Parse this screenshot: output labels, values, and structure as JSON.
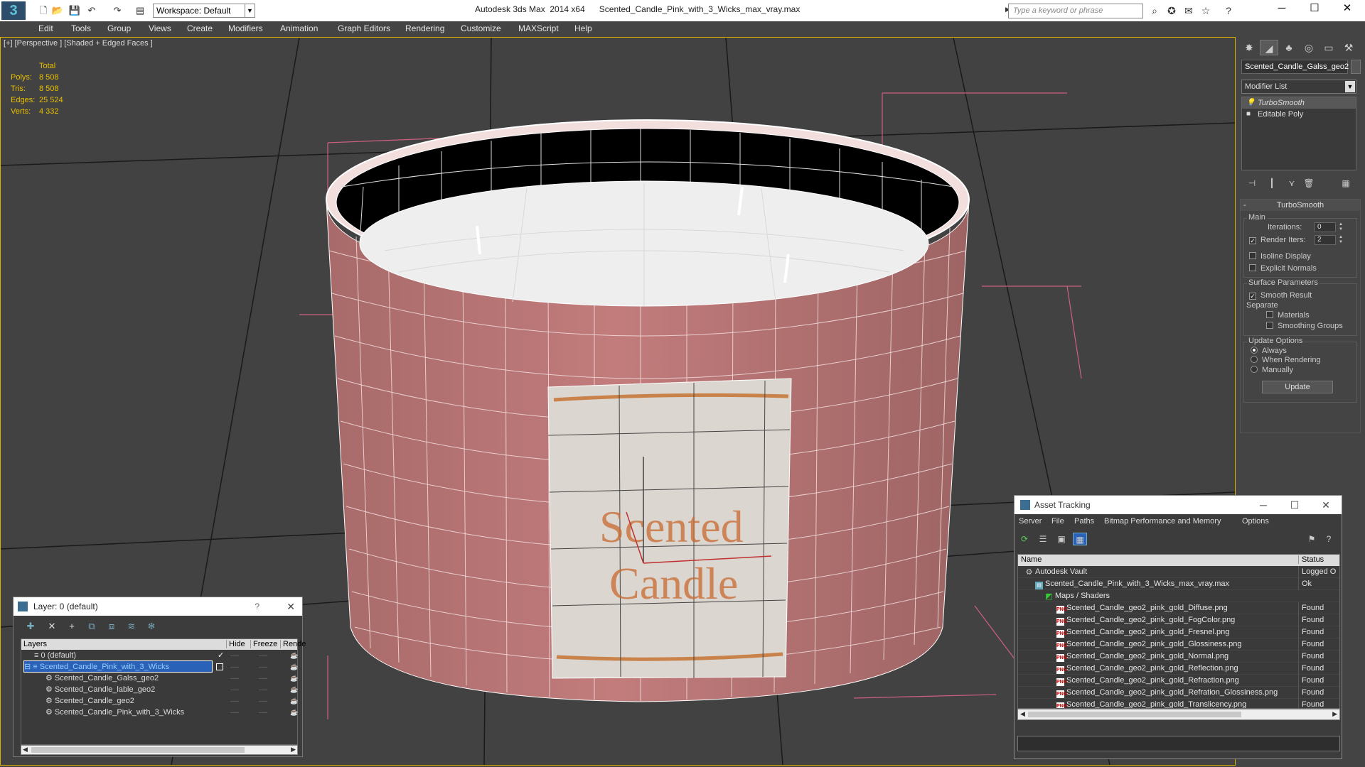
{
  "titlebar": {
    "app_title": "Autodesk 3ds Max  2014 x64      Scented_Candle_Pink_with_3_Wicks_max_vray.max",
    "workspace_label": "Workspace: Default",
    "search_placeholder": "Type a keyword or phrase",
    "minimize": "─",
    "maximize": "☐",
    "close": "✕"
  },
  "menu": [
    "Edit",
    "Tools",
    "Group",
    "Views",
    "Create",
    "Modifiers",
    "Animation",
    "Graph Editors",
    "Rendering",
    "Customize",
    "MAXScript",
    "Help"
  ],
  "viewport": {
    "label": "[+] [Perspective ] [Shaded + Edged Faces ]",
    "stats_header": "Total",
    "stats": [
      {
        "label": "Polys:",
        "value": "8 508"
      },
      {
        "label": "Tris:",
        "value": "8 508"
      },
      {
        "label": "Edges:",
        "value": "25 524"
      },
      {
        "label": "Verts:",
        "value": "4 332"
      }
    ],
    "label_text_line1": "Scented",
    "label_text_line2": "Candle"
  },
  "command_panel": {
    "object_name": "Scented_Candle_Galss_geo2",
    "modifier_list": "Modifier List",
    "stack": [
      "TurboSmooth",
      "Editable Poly"
    ],
    "rollout_title": "TurboSmooth",
    "main_group": "Main",
    "iterations_label": "Iterations:",
    "iterations_value": "0",
    "render_iters_label": "Render Iters:",
    "render_iters_value": "2",
    "isoline_display": "Isoline Display",
    "explicit_normals": "Explicit Normals",
    "surface_group": "Surface Parameters",
    "smooth_result": "Smooth Result",
    "separate_label": "Separate",
    "materials": "Materials",
    "smoothing_groups": "Smoothing Groups",
    "update_group": "Update Options",
    "always": "Always",
    "when_rendering": "When Rendering",
    "manually": "Manually",
    "update_button": "Update"
  },
  "layer_window": {
    "title": "Layer: 0 (default)",
    "help": "?",
    "close": "✕",
    "columns": [
      "Layers",
      "Hide",
      "Freeze",
      "Rende"
    ],
    "rows": [
      {
        "name": "0 (default)"
      },
      {
        "name": "Scented_Candle_Pink_with_3_Wicks"
      },
      {
        "name": "Scented_Candle_Galss_geo2"
      },
      {
        "name": "Scented_Candle_lable_geo2"
      },
      {
        "name": "Scented_Candle_geo2"
      },
      {
        "name": "Scented_Candle_Pink_with_3_Wicks"
      }
    ],
    "dash": "----"
  },
  "asset_window": {
    "title": "Asset Tracking",
    "minimize": "─",
    "maximize": "☐",
    "close": "✕",
    "menu": [
      "Server",
      "File",
      "Paths",
      "Bitmap Performance and Memory",
      "Options"
    ],
    "columns": [
      "Name",
      "Status"
    ],
    "rows": [
      {
        "name": "Autodesk Vault",
        "status": "Logged O"
      },
      {
        "name": "Scented_Candle_Pink_with_3_Wicks_max_vray.max",
        "status": "Ok"
      },
      {
        "name": "Maps / Shaders",
        "status": ""
      },
      {
        "name": "Scented_Candle_geo2_pink_gold_Diffuse.png",
        "status": "Found"
      },
      {
        "name": "Scented_Candle_geo2_pink_gold_FogColor.png",
        "status": "Found"
      },
      {
        "name": "Scented_Candle_geo2_pink_gold_Fresnel.png",
        "status": "Found"
      },
      {
        "name": "Scented_Candle_geo2_pink_gold_Glossiness.png",
        "status": "Found"
      },
      {
        "name": "Scented_Candle_geo2_pink_gold_Normal.png",
        "status": "Found"
      },
      {
        "name": "Scented_Candle_geo2_pink_gold_Reflection.png",
        "status": "Found"
      },
      {
        "name": "Scented_Candle_geo2_pink_gold_Refraction.png",
        "status": "Found"
      },
      {
        "name": "Scented_Candle_geo2_pink_gold_Refration_Glossiness.png",
        "status": "Found"
      },
      {
        "name": "Scented_Candle_geo2_pink_gold_Translicency.png",
        "status": "Found"
      }
    ],
    "png_tag": "PNG"
  },
  "colors": {
    "candle_pink": "#b07070",
    "wax": "#eeeeee",
    "stats_yellow": "#e8c000",
    "selection_blue": "#2a62b8"
  }
}
